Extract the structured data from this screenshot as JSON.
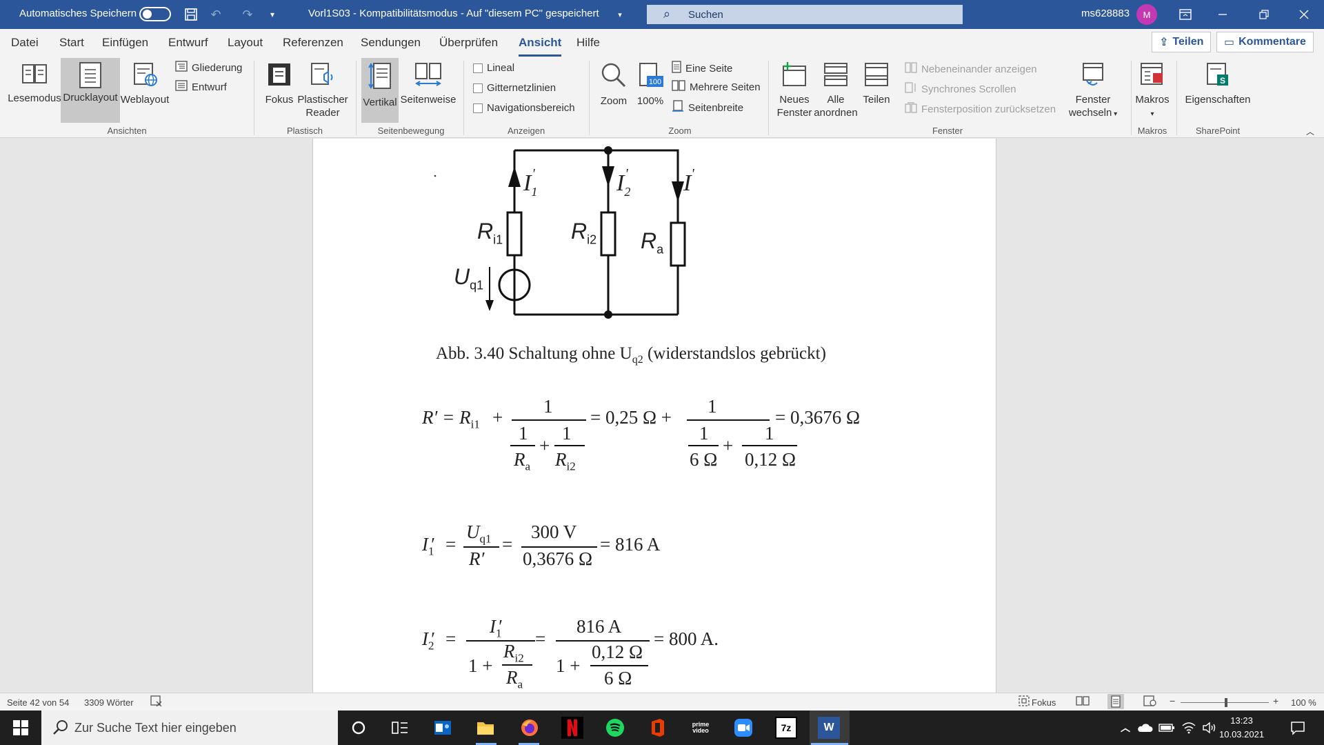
{
  "titlebar": {
    "autosave_label": "Automatisches Speichern",
    "doc_title": "Vorl1S03  -  Kompatibilitätsmodus  -  Auf \"diesem PC\" gespeichert",
    "search_label": "Suchen",
    "username": "ms628883",
    "avatar_initial": "M"
  },
  "menu": {
    "tabs": [
      "Datei",
      "Start",
      "Einfügen",
      "Entwurf",
      "Layout",
      "Referenzen",
      "Sendungen",
      "Überprüfen",
      "Ansicht",
      "Hilfe"
    ],
    "active_tab": "Ansicht",
    "share_label": "Teilen",
    "comments_label": "Kommentare"
  },
  "ribbon": {
    "ansichten": {
      "lesemodus": "Lesemodus",
      "drucklayout": "Drucklayout",
      "weblayout": "Weblayout",
      "gliederung": "Gliederung",
      "entwurf": "Entwurf",
      "group": "Ansichten"
    },
    "plastisch": {
      "fokus": "Fokus",
      "reader_1": "Plastischer",
      "reader_2": "Reader",
      "group": "Plastisch"
    },
    "seitenbewegung": {
      "vertikal": "Vertikal",
      "seitenweise": "Seitenweise",
      "group": "Seitenbewegung"
    },
    "anzeigen": {
      "lineal": "Lineal",
      "gitternetz": "Gitternetzlinien",
      "navigation": "Navigationsbereich",
      "group": "Anzeigen"
    },
    "zoom": {
      "zoom": "Zoom",
      "hundert": "100%",
      "eine_seite": "Eine Seite",
      "mehrere_seiten": "Mehrere Seiten",
      "seitenbreite": "Seitenbreite",
      "group": "Zoom"
    },
    "fenster": {
      "neues_1": "Neues",
      "neues_2": "Fenster",
      "alle_1": "Alle",
      "alle_2": "anordnen",
      "teilen": "Teilen",
      "nebeneinander": "Nebeneinander anzeigen",
      "synchron": "Synchrones Scrollen",
      "position": "Fensterposition zurücksetzen",
      "wechseln_1": "Fenster",
      "wechseln_2": "wechseln",
      "group": "Fenster"
    },
    "makros": {
      "makros": "Makros",
      "group": "Makros"
    },
    "sharepoint": {
      "eigenschaften": "Eigenschaften",
      "group": "SharePoint"
    }
  },
  "document": {
    "circuit": {
      "i1": "I",
      "i1_sub": "1",
      "i2": "I",
      "i2_sub": "2",
      "i3": "I",
      "ri1": "R",
      "ri1_sub": "i1",
      "ri2": "R",
      "ri2_sub": "i2",
      "ra": "R",
      "ra_sub": "a",
      "uq1": "U",
      "uq1_sub": "q1"
    },
    "caption_main": "Abb. 3.40 Schaltung ohne U",
    "caption_sub": "q2",
    "caption_tail": " (widerstandslos gebrückt)",
    "eq1": {
      "lhs": "R′ = R",
      "lhs_sub": "i1",
      "plus": "+",
      "one": "1",
      "ra": "R",
      "ra_sub": "a",
      "ri2": "R",
      "ri2_sub": "i2",
      "mid": "= 0,25 Ω +",
      "d1": "6 Ω",
      "d2": "0,12 Ω",
      "result": "= 0,3676 Ω"
    },
    "eq2": {
      "lhs": "I",
      "lhs_sub": "1",
      "prime": "′",
      "eq": "=",
      "num": "U",
      "num_sub": "q1",
      "den": "R′",
      "num2": "300 V",
      "den2": "0,3676 Ω",
      "result": "= 816 A"
    },
    "eq3": {
      "lhs": "I",
      "lhs_sub": "2",
      "prime": "′",
      "eq": "=",
      "num": "I",
      "num_sub": "1",
      "den_a": "1 +",
      "frac_num": "R",
      "frac_num_sub": "i2",
      "frac_den": "R",
      "frac_den_sub": "a",
      "num2": "816 A",
      "den2_a": "1 +",
      "frac2_num": "0,12 Ω",
      "frac2_den": "6 Ω",
      "result": "= 800 A."
    }
  },
  "statusbar": {
    "page": "Seite 42 von 54",
    "words": "3309 Wörter",
    "focus": "Fokus",
    "zoom": "100 %",
    "minus": "−",
    "plus": "+"
  },
  "taskbar": {
    "search_placeholder": "Zur Suche Text hier eingeben",
    "prime_label": "prime video",
    "zip_label": "7z",
    "word_label": "W",
    "time": "13:23",
    "date": "10.03.2021"
  }
}
